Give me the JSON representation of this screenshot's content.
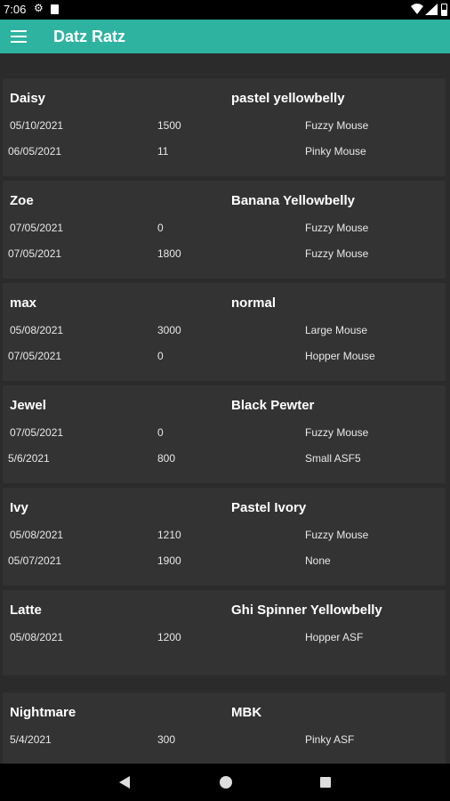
{
  "status_bar": {
    "time": "7:06"
  },
  "app_bar": {
    "title": "Datz Ratz"
  },
  "snakes": [
    {
      "name": "Daisy",
      "morph": "pastel yellowbelly",
      "feedings": [
        {
          "date": "05/10/2021",
          "weight": "1500",
          "food": "Fuzzy Mouse"
        },
        {
          "date": "06/05/2021",
          "weight": "11",
          "food": "Pinky Mouse"
        }
      ]
    },
    {
      "name": "Zoe",
      "morph": "Banana Yellowbelly",
      "feedings": [
        {
          "date": "07/05/2021",
          "weight": "0",
          "food": "Fuzzy Mouse"
        },
        {
          "date": "07/05/2021",
          "weight": "1800",
          "food": "Fuzzy Mouse"
        }
      ]
    },
    {
      "name": "max",
      "morph": "normal",
      "feedings": [
        {
          "date": "05/08/2021",
          "weight": "3000",
          "food": "Large Mouse"
        },
        {
          "date": "07/05/2021",
          "weight": "0",
          "food": "Hopper Mouse"
        }
      ]
    },
    {
      "name": "Jewel",
      "morph": "Black Pewter",
      "feedings": [
        {
          "date": "07/05/2021",
          "weight": "0",
          "food": "Fuzzy Mouse"
        },
        {
          "date": "5/6/2021",
          "weight": "800",
          "food": "Small ASF5"
        }
      ]
    },
    {
      "name": "Ivy",
      "morph": "Pastel Ivory",
      "feedings": [
        {
          "date": "05/08/2021",
          "weight": "1210",
          "food": "Fuzzy Mouse"
        },
        {
          "date": "05/07/2021",
          "weight": "1900",
          "food": "None"
        }
      ]
    },
    {
      "name": "Latte",
      "morph": "Ghi Spinner Yellowbelly",
      "feedings": [
        {
          "date": "05/08/2021",
          "weight": "1200",
          "food": "Hopper ASF"
        }
      ]
    },
    {
      "name": "Nightmare",
      "morph": "MBK",
      "feedings": [
        {
          "date": "5/4/2021",
          "weight": "300",
          "food": "Pinky ASF"
        }
      ]
    }
  ]
}
